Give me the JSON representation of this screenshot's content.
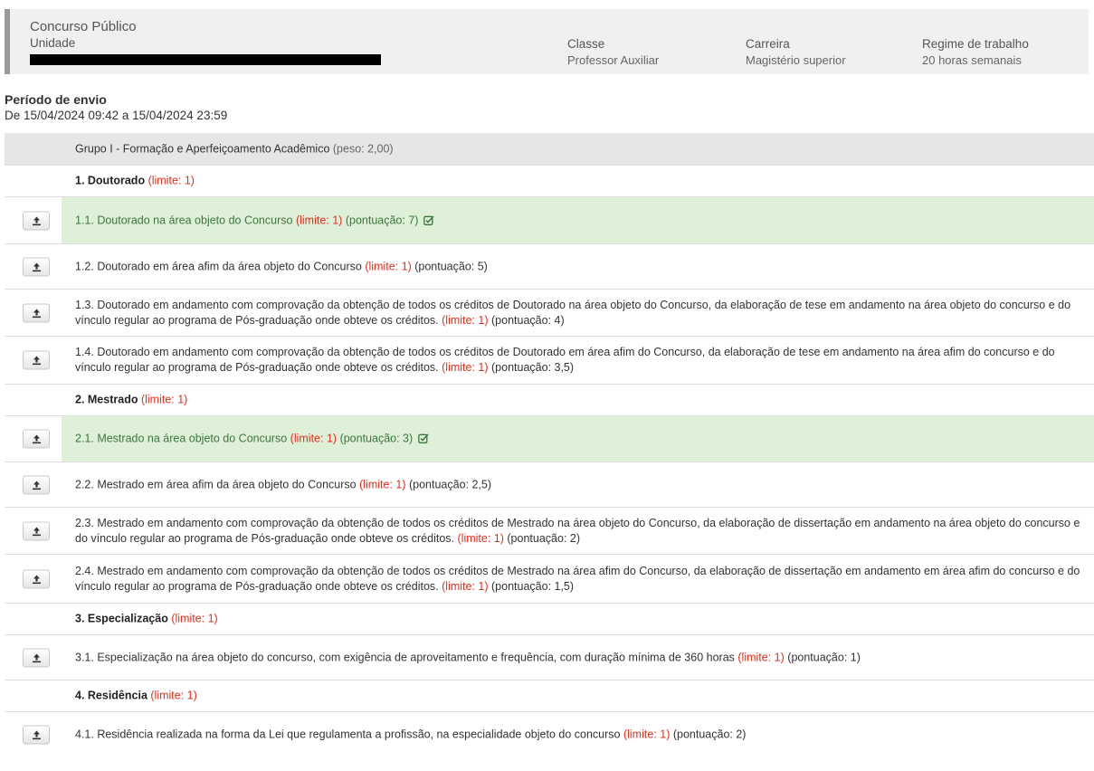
{
  "header": {
    "title": "Concurso Público",
    "unit_label": "Unidade",
    "classe_label": "Classe",
    "classe_value": "Professor Auxiliar",
    "carreira_label": "Carreira",
    "carreira_value": "Magistério superior",
    "regime_label": "Regime de trabalho",
    "regime_value": "20 horas semanais"
  },
  "period": {
    "label": "Período de envio",
    "value": "De 15/04/2024 09:42 a 15/04/2024 23:59"
  },
  "group": {
    "title": "Grupo I - Formação e Aperfeiçoamento Acadêmico",
    "weight": "(peso: 2,00)"
  },
  "sections": [
    {
      "title": "1. Doutorado",
      "limit": "(limite: 1)",
      "items": [
        {
          "text": "1.1. Doutorado na área objeto do Concurso",
          "limit": "(limite: 1)",
          "score": "(pontuação: 7)"
        },
        {
          "text": "1.2. Doutorado em área afim da área objeto do Concurso",
          "limit": "(limite: 1)",
          "score": "(pontuação: 5)"
        },
        {
          "text": "1.3. Doutorado em andamento com comprovação da obtenção de todos os créditos de Doutorado na área objeto do Concurso, da elaboração de tese em andamento na área objeto do concurso e do vínculo regular ao programa de Pós-graduação onde obteve os créditos.",
          "limit": "(limite: 1)",
          "score": "(pontuação: 4)"
        },
        {
          "text": "1.4. Doutorado em andamento com comprovação da obtenção de todos os créditos de Doutorado em área afim do Concurso, da elaboração de tese em andamento na área afim do concurso e do vínculo regular ao programa de Pós-graduação onde obteve os créditos.",
          "limit": "(limite: 1)",
          "score": "(pontuação: 3,5)"
        }
      ]
    },
    {
      "title": "2. Mestrado",
      "limit": "(limite: 1)",
      "items": [
        {
          "text": "2.1. Mestrado na área objeto do Concurso",
          "limit": "(limite: 1)",
          "score": "(pontuação: 3)"
        },
        {
          "text": "2.2. Mestrado em área afim da área objeto do Concurso",
          "limit": "(limite: 1)",
          "score": "(pontuação: 2,5)"
        },
        {
          "text": "2.3. Mestrado em andamento com comprovação da obtenção de todos os créditos de Mestrado na área objeto do Concurso, da elaboração de dissertação em andamento na área objeto do concurso e do vínculo regular ao programa de Pós-graduação onde obteve os créditos.",
          "limit": "(limite: 1)",
          "score": "(pontuação: 2)"
        },
        {
          "text": "2.4. Mestrado em andamento com comprovação da obtenção de todos os créditos de Mestrado na área afim do Concurso, da elaboração de dissertação em andamento em área afim do concurso e do vínculo regular ao programa de Pós-graduação onde obteve os créditos.",
          "limit": "(limite: 1)",
          "score": "(pontuação: 1,5)"
        }
      ]
    },
    {
      "title": "3. Especialização",
      "limit": "(limite: 1)",
      "items": [
        {
          "text": "3.1. Especialização na área objeto do concurso, com exigência de aproveitamento e frequência, com duração mínima de 360 horas",
          "limit": "(limite: 1)",
          "score": "(pontuação: 1)"
        }
      ]
    },
    {
      "title": "4. Residência",
      "limit": "(limite: 1)",
      "items": [
        {
          "text": "4.1. Residência realizada na forma da Lei que regulamenta a profissão, na especialidade objeto do concurso",
          "limit": "(limite: 1)",
          "score": "(pontuação: 2)"
        }
      ]
    }
  ],
  "colors": {
    "highlight_bg": "#dff0d8",
    "highlight_text": "#3c763d",
    "limit_red": "#e0301e",
    "group_bg": "#e6e6e6"
  },
  "icons": {
    "upload": "upload-icon",
    "check": "check-square-icon"
  }
}
